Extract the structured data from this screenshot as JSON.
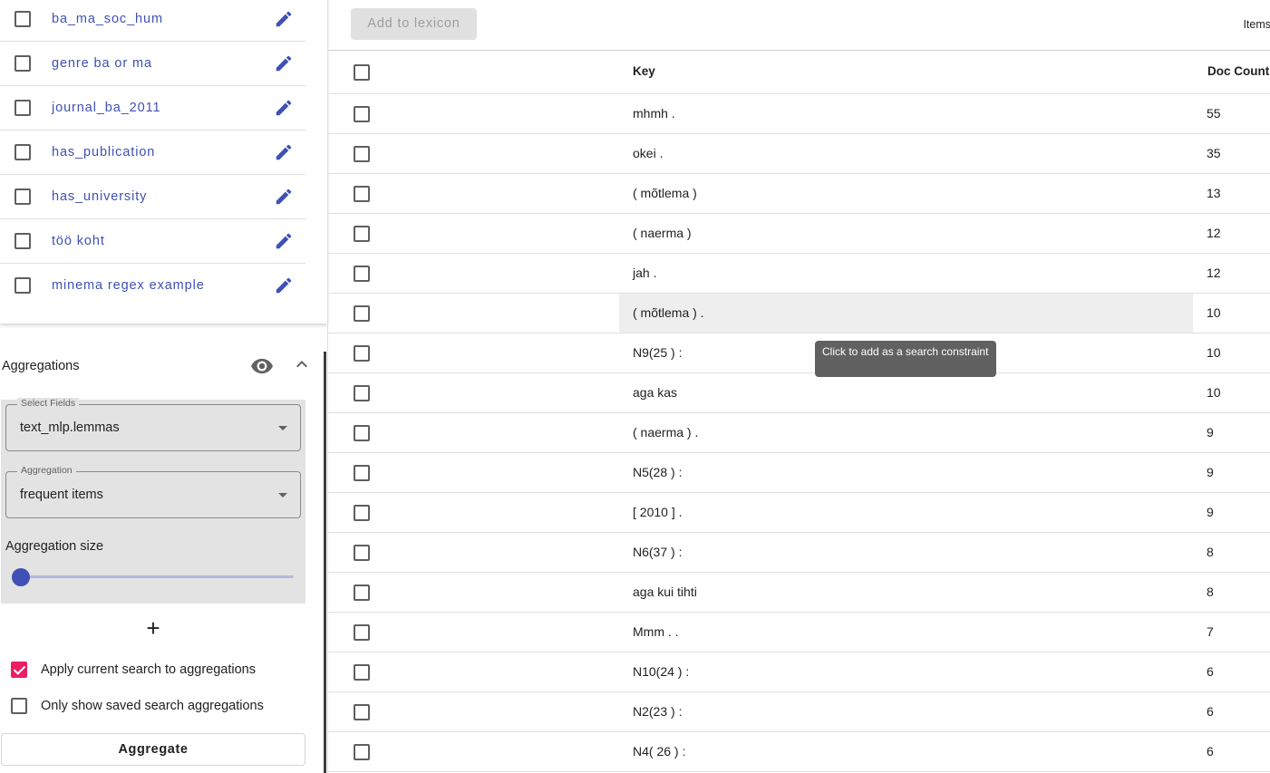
{
  "saved_searches": [
    {
      "label": "ba_ma_soc_hum"
    },
    {
      "label": "genre ba or ma"
    },
    {
      "label": "journal_ba_2011"
    },
    {
      "label": "has_publication"
    },
    {
      "label": "has_university"
    },
    {
      "label": "töö koht"
    },
    {
      "label": "minema regex example"
    }
  ],
  "aggregations": {
    "title": "Aggregations",
    "select_fields": {
      "label": "Select Fields",
      "value": "text_mlp.lemmas"
    },
    "aggregation": {
      "label": "Aggregation",
      "value": "frequent items"
    },
    "size_label": "Aggregation size",
    "size_value": 0,
    "add_symbol": "+",
    "apply_current_search": {
      "label": "Apply current search to aggregations",
      "checked": true
    },
    "only_saved": {
      "label": "Only show saved search aggregations",
      "checked": false
    },
    "aggregate_button": "Aggregate"
  },
  "toolbar": {
    "add_to_lexicon": "Add to lexicon",
    "items_label": "Items"
  },
  "table": {
    "columns": {
      "key": "Key",
      "doc_count": "Doc Count"
    },
    "rows": [
      {
        "key": "mhmh .",
        "count": "55"
      },
      {
        "key": "okei .",
        "count": "35"
      },
      {
        "key": "( mõtlema )",
        "count": "13"
      },
      {
        "key": "( naerma )",
        "count": "12"
      },
      {
        "key": "jah .",
        "count": "12"
      },
      {
        "key": "( mõtlema ) .",
        "count": "10"
      },
      {
        "key": "N9(25 ) :",
        "count": "10"
      },
      {
        "key": "aga kas",
        "count": "10"
      },
      {
        "key": "( naerma ) .",
        "count": "9"
      },
      {
        "key": "N5(28 ) :",
        "count": "9"
      },
      {
        "key": "[ 2010 ] .",
        "count": "9"
      },
      {
        "key": "N6(37 ) :",
        "count": "8"
      },
      {
        "key": "aga kui tihti",
        "count": "8"
      },
      {
        "key": "Mmm . .",
        "count": "7"
      },
      {
        "key": "N10(24 ) :",
        "count": "6"
      },
      {
        "key": "N2(23 ) :",
        "count": "6"
      },
      {
        "key": "N4( 26 ) :",
        "count": "6"
      }
    ]
  },
  "tooltip": "Click to add as a search constraint",
  "colors": {
    "accent": "#3f51b5",
    "checkbox_checked": "#e91e63"
  }
}
